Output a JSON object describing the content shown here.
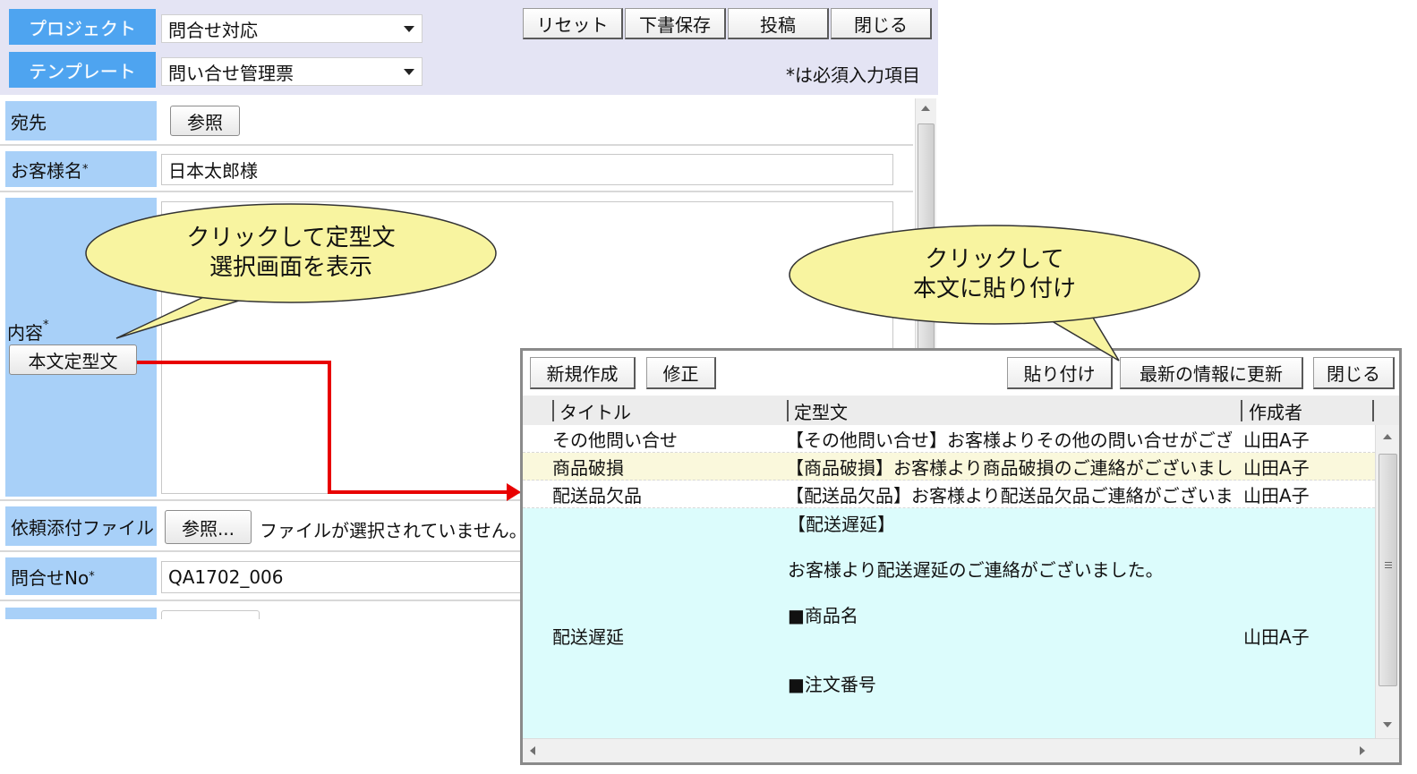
{
  "header": {
    "project_label": "プロジェクト",
    "project_value": "問合せ対応",
    "template_label": "テンプレート",
    "template_value": "問い合せ管理票",
    "buttons": {
      "reset": "リセット",
      "save_draft": "下書保存",
      "post": "投稿",
      "close": "閉じる"
    },
    "required_note": "*は必須入力項目"
  },
  "form": {
    "to_label": "宛先",
    "browse_label": "参照",
    "customer_label": "お客様名",
    "customer_value": "日本太郎様",
    "content_label": "内容",
    "template_text_button": "本文定型文",
    "attach_label": "依頼添付ファイル",
    "attach_browse": "参照...",
    "attach_status": "ファイルが選択されていません。",
    "inquiry_no_label": "問合せNo",
    "inquiry_no_value": "QA1702_006",
    "required_mark": "*"
  },
  "dialog": {
    "buttons": {
      "new": "新規作成",
      "edit": "修正",
      "paste": "貼り付け",
      "refresh": "最新の情報に更新",
      "close": "閉じる"
    },
    "columns": {
      "title": "タイトル",
      "template": "定型文",
      "author": "作成者"
    },
    "rows": [
      {
        "title": "その他問い合せ",
        "text": "【その他問い合せ】お客様よりその他の問い合せがござ",
        "author": "山田A子"
      },
      {
        "title": "商品破損",
        "text": "【商品破損】お客様より商品破損のご連絡がございまし",
        "author": "山田A子"
      },
      {
        "title": "配送品欠品",
        "text": "【配送品欠品】お客様より配送品欠品ご連絡がございま",
        "author": "山田A子"
      }
    ],
    "expanded_row": {
      "title": "配送遅延",
      "line1": "【配送遅延】",
      "line2": "お客様より配送遅延のご連絡がございました。",
      "line3": "■商品名",
      "line4": "■注文番号",
      "author": "山田A子"
    }
  },
  "callouts": {
    "left_line1": "クリックして定型文",
    "left_line2": "選択画面を表示",
    "right_line1": "クリックして",
    "right_line2": "本文に貼り付け"
  },
  "colors": {
    "header_bg": "#e4e4f4",
    "header_label_bg": "#4ea4f0",
    "field_label_bg": "#a8d0f8",
    "selected_row_bg": "#faf8dc",
    "expanded_row_bg": "#dcfcfc",
    "callout_fill": "#f8f4a0",
    "arrow": "#e80000"
  }
}
